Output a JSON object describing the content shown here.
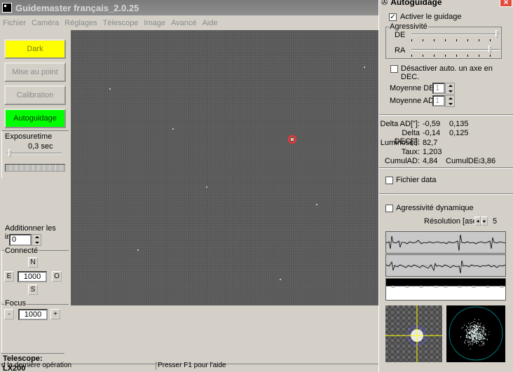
{
  "main": {
    "title": "Guidemaster français_2.0.25",
    "menu": [
      "Fichier",
      "Caméra",
      "Réglages",
      "Télescope",
      "Image",
      "Avancé",
      "Aide"
    ],
    "buttons": {
      "dark": "Dark",
      "focus_mode": "Mise au point",
      "calibration": "Calibration",
      "autoguide": "Autoguidage"
    },
    "exposure": {
      "label": "Exposuretime",
      "value": "0,3 sec"
    },
    "add_images": {
      "label": "Additionner les images",
      "value": "0"
    },
    "connected": {
      "label": "Connecté",
      "north": "N",
      "east": "E",
      "west": "O",
      "south": "S",
      "speed": "1000"
    },
    "focus": {
      "label": "Focus",
      "minus": "-",
      "plus": "+",
      "step": "1000"
    },
    "telescope": "Telescope: LX200",
    "status_left": "d la dernière opération",
    "status_right": "Presser F1 pour l'aide"
  },
  "autoguide": {
    "title": "Autoguidage",
    "close": "×",
    "activate_guiding": "Activer le guidage",
    "activate_checked": "✓",
    "aggressivity": {
      "label": "Agressivité",
      "de": "DE",
      "ra": "RA"
    },
    "disable_axis": "Désactiver auto. un axe en DEC.",
    "avg_dec": {
      "label": "Moyenne DEC:",
      "value": "1"
    },
    "avg_ad": {
      "label": "Moyenne AD:",
      "value": "1"
    },
    "stats": {
      "delta_ad": {
        "label": "Delta AD[\"]:",
        "v1": "-0,59",
        "v2": "0,135"
      },
      "delta_dec": {
        "label": "Delta DEC[\"]:",
        "v1": "-0,14",
        "v2": "0,125"
      },
      "luminosity": {
        "label": "Luminosité:",
        "value": "82,7"
      },
      "rate": {
        "label": "Taux:",
        "value": "1,203"
      },
      "cumul_ad": {
        "label": "CumulAD:",
        "value": "4,84"
      },
      "cumul_de": {
        "label": "CumulDE:",
        "value": "-3,86"
      }
    },
    "data_file": "Fichier data",
    "dynamic_aggressivity": "Agressivité dynamique",
    "resolution": {
      "label": "Résolution [asec]:",
      "value": "5",
      "left": "◂",
      "right": "▸"
    }
  },
  "colors": {
    "dark_button": "#ffff00",
    "autoguide_button": "#00ff00",
    "guide_star_marker": "#ff3030"
  }
}
